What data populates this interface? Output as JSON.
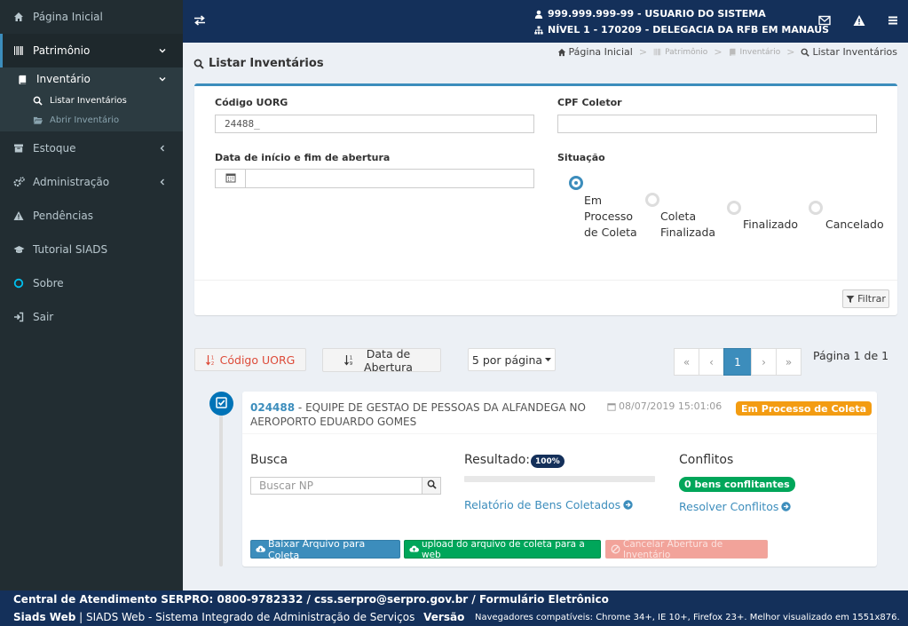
{
  "sidebar": {
    "items": [
      {
        "label": "Página Inicial",
        "icon": "home-icon"
      },
      {
        "label": "Patrimônio",
        "icon": "barcode-icon"
      },
      {
        "label": "Inventário",
        "icon": "book-icon"
      },
      {
        "label": "Listar Inventários",
        "icon": "search-icon"
      },
      {
        "label": "Abrir Inventário",
        "icon": "folder-open-icon"
      },
      {
        "label": "Estoque",
        "icon": "archive-icon"
      },
      {
        "label": "Administração",
        "icon": "cogs-icon"
      },
      {
        "label": "Pendências",
        "icon": "warning-icon"
      },
      {
        "label": "Tutorial SIADS",
        "icon": "graduation-cap-icon"
      },
      {
        "label": "Sobre",
        "icon": "circle-icon"
      },
      {
        "label": "Sair",
        "icon": "sign-out-icon"
      }
    ]
  },
  "header": {
    "user_line": "999.999.999-99 - USUARIO DO SISTEMA",
    "unit_line": "NÍVEL 1 - 170209 - DELEGACIA DA RFB EM MANAUS"
  },
  "page": {
    "title": "Listar Inventários",
    "breadcrumb": [
      "Página Inicial",
      "Patrimônio",
      "Inventário",
      "Listar Inventários"
    ]
  },
  "filter": {
    "uorg_label": "Código UORG",
    "uorg_value": "24488_",
    "cpf_label": "CPF Coletor",
    "cpf_value": "",
    "date_label": "Data de início e fim de abertura",
    "situacao_label": "Situação",
    "options": [
      {
        "label": "Em Processo de Coleta",
        "selected": true
      },
      {
        "label": "Coleta Finalizada",
        "selected": false
      },
      {
        "label": "Finalizado",
        "selected": false
      },
      {
        "label": "Cancelado",
        "selected": false
      }
    ],
    "filter_button": "Filtrar"
  },
  "listing": {
    "sort_uorg": "Código UORG",
    "sort_date": "Data de Abertura",
    "per_page": "5 por página",
    "pager": [
      "«",
      "‹",
      "1",
      "›",
      "»"
    ],
    "page_info": "Página 1 de 1"
  },
  "inventory": {
    "code": "024488",
    "name": " - EQUIPE DE GESTAO DE PESSOAS DA ALFANDEGA NO AEROPORTO EDUARDO GOMES",
    "date": "08/07/2019 15:01:06",
    "status": "Em Processo de Coleta",
    "busca_title": "Busca",
    "busca_placeholder": "Buscar NP",
    "resultado_title": "Resultado:",
    "resultado_badge": "100%",
    "progress": 1.0,
    "relatorio_link": "Relatório de Bens Coletados",
    "conflitos_title": "Conflitos",
    "conflitos_badge": "0 bens conflitantes",
    "resolver_link": "Resolver Conflitos",
    "btn_download": "Baixar Arquivo para Coleta",
    "btn_upload": "upload do arquivo de coleta para a web",
    "btn_cancel": "Cancelar Abertura de Inventário"
  },
  "footer": {
    "line1": "Central de Atendimento SERPRO: 0800-9782332 / css.serpro@serpro.gov.br / Formulário Eletrônico",
    "app_name": "Siads Web",
    "app_desc": " | SIADS Web - Sistema Integrado de Administração de Serviços",
    "version_label": "Versão",
    "browsers": "Navegadores compatíveis: Chrome 34+, IE 10+, Firefox 23+. Melhor visualizado em 1551x876."
  },
  "colors": {
    "primary": "#3c8dbc",
    "navy": "#14305a",
    "sidebar": "#222d32",
    "warning": "#f39c12",
    "success": "#00a65a",
    "danger_disabled": "#f2a39a"
  }
}
